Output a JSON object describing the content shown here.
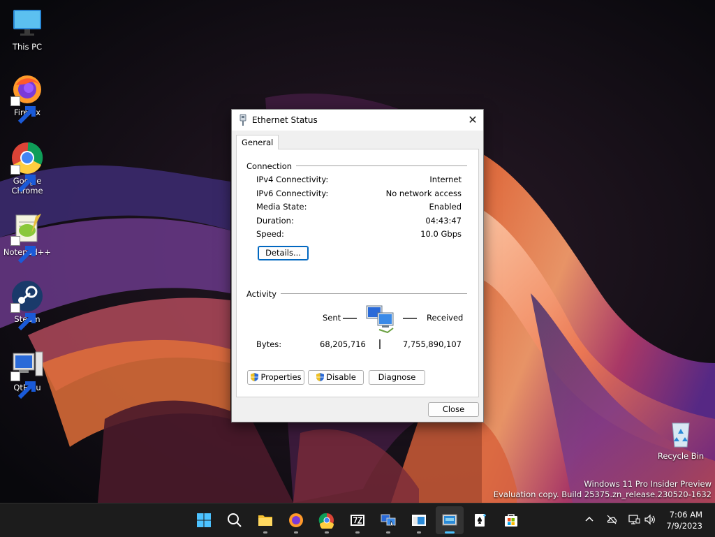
{
  "desktop": {
    "icons": [
      {
        "label": "This PC"
      },
      {
        "label": "Firefox"
      },
      {
        "label": "Google\nChrome"
      },
      {
        "label": "Notepad++"
      },
      {
        "label": "Steam"
      },
      {
        "label": "QtEmu"
      },
      {
        "label": "Recycle Bin"
      }
    ],
    "watermark": {
      "line1": "Windows 11 Pro Insider Preview",
      "line2": "Evaluation copy. Build 25375.zn_release.230520-1632"
    }
  },
  "dialog": {
    "title": "Ethernet Status",
    "tab": "General",
    "connection": {
      "heading": "Connection",
      "rows": [
        {
          "label": "IPv4 Connectivity:",
          "value": "Internet"
        },
        {
          "label": "IPv6 Connectivity:",
          "value": "No network access"
        },
        {
          "label": "Media State:",
          "value": "Enabled"
        },
        {
          "label": "Duration:",
          "value": "04:43:47"
        },
        {
          "label": "Speed:",
          "value": "10.0 Gbps"
        }
      ],
      "details_button": "Details..."
    },
    "activity": {
      "heading": "Activity",
      "sent_label": "Sent",
      "received_label": "Received",
      "bytes_label": "Bytes:",
      "bytes_sent": "68,205,716",
      "bytes_received": "7,755,890,107"
    },
    "buttons": {
      "properties": "Properties",
      "disable": "Disable",
      "diagnose": "Diagnose",
      "close": "Close"
    }
  },
  "taskbar": {
    "apps": [
      "start-icon",
      "search-icon",
      "file-explorer-icon",
      "firefox-icon",
      "chrome-icon",
      "7zip-icon",
      "network-connections-icon",
      "window-icon",
      "qtemu-icon",
      "solitaire-icon",
      "store-icon"
    ],
    "clock": {
      "time": "7:06 AM",
      "date": "7/9/2023"
    },
    "accent": "#4cc2ff"
  },
  "colors": {
    "focus_blue": "#0067c0"
  }
}
